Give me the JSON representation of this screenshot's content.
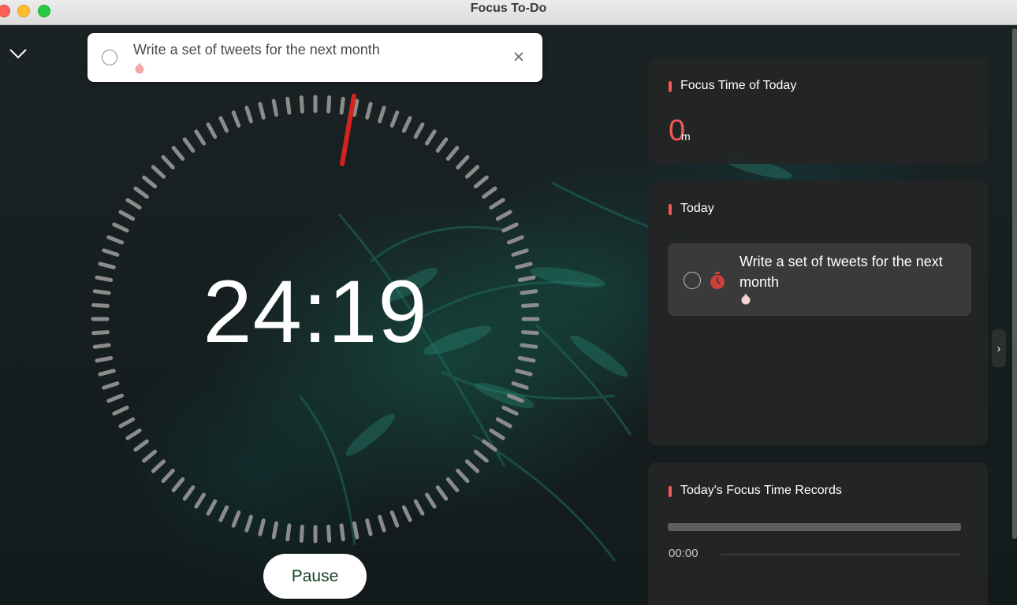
{
  "window": {
    "title": "Focus To-Do"
  },
  "current_task": {
    "title": "Write a set of tweets for the next month",
    "pomodoro_icon": "tomato-icon"
  },
  "timer": {
    "display": "24:19",
    "pause_label": "Pause"
  },
  "focus_today": {
    "heading": "Focus Time of Today",
    "value": "0",
    "unit": "m"
  },
  "today": {
    "heading": "Today",
    "tasks": [
      {
        "title": "Write a set of tweets for the next month",
        "icon": "stopwatch-icon"
      }
    ]
  },
  "records": {
    "heading": "Today's Focus Time Records",
    "start_time": "00:00"
  },
  "side_toggle": {
    "label": "›"
  },
  "colors": {
    "accent": "#f25a55",
    "pause_text": "#174226",
    "panel_bg": "#252525"
  }
}
